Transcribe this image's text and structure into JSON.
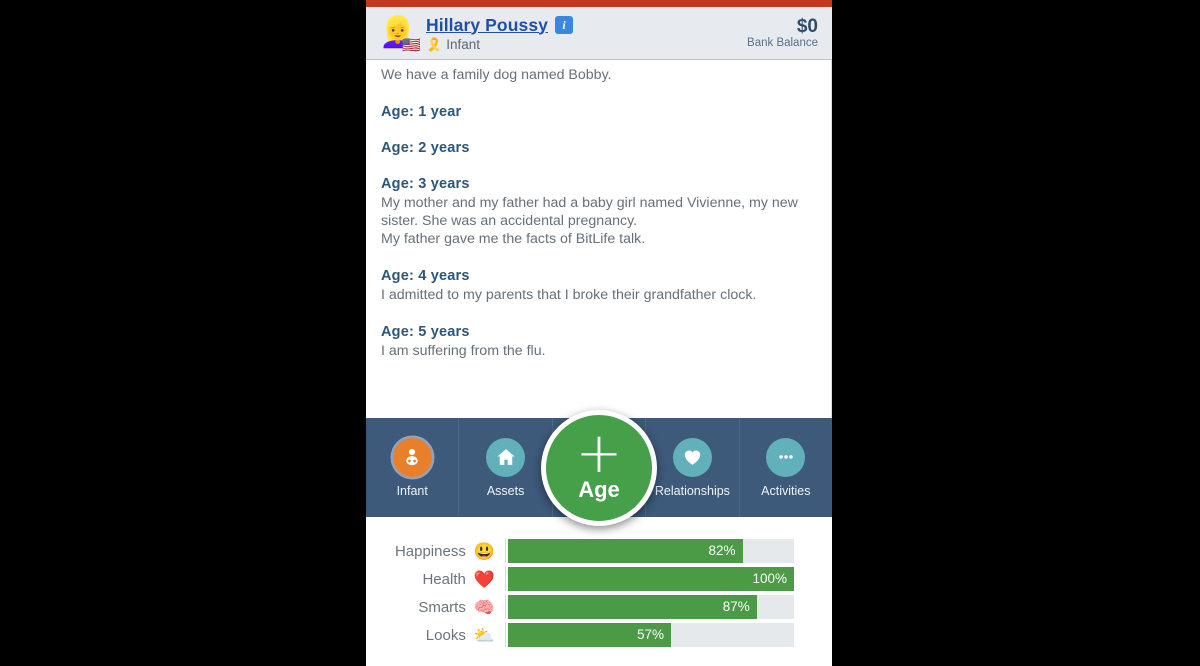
{
  "status_strip_color": "#c03a1d",
  "header": {
    "avatar_icon": "blonde-woman-emoji",
    "avatar_glyph": "👱‍♀️",
    "flag_icon": "us-flag",
    "flag_glyph": "🇺🇸",
    "name": "Hillary Poussy",
    "info_badge": "i",
    "stage_icon": "ribbon-icon",
    "stage_glyph": "🎗️",
    "stage_label": "Infant",
    "bank_amount": "$0",
    "bank_label": "Bank Balance"
  },
  "events": {
    "intro_line": "We have a family dog named Bobby.",
    "entries": [
      {
        "heading": "Age: 1 year",
        "lines": []
      },
      {
        "heading": "Age: 2 years",
        "lines": []
      },
      {
        "heading": "Age: 3 years",
        "lines": [
          "My mother and my father had a baby girl named Vivienne, my new sister. She was an accidental pregnancy.",
          "My father gave me the facts of BitLife talk."
        ]
      },
      {
        "heading": "Age: 4 years",
        "lines": [
          "I admitted to my parents that I broke their grandfather clock."
        ]
      },
      {
        "heading": "Age: 5 years",
        "lines": [
          "I am suffering from the flu."
        ]
      }
    ]
  },
  "nav": {
    "background": "#3d5a7a",
    "items": [
      {
        "label": "Infant",
        "icon": "baby-icon",
        "active": true,
        "color": "#e8802b"
      },
      {
        "label": "Assets",
        "icon": "house-icon",
        "active": false,
        "color": "#62b0ba"
      },
      {
        "label": "Relationships",
        "icon": "heart-icon",
        "active": false,
        "color": "#62b0ba"
      },
      {
        "label": "Activities",
        "icon": "ellipsis-icon",
        "active": false,
        "color": "#62b0ba"
      }
    ],
    "age_button": {
      "label": "Age",
      "icon": "plus-icon",
      "color": "#46a04a"
    }
  },
  "stats": {
    "bar_color": "#4a9a46",
    "track_color": "#e6e9eb",
    "rows": [
      {
        "label": "Happiness",
        "icon": "grinning-face-icon",
        "glyph": "😃",
        "value": 82,
        "display": "82%"
      },
      {
        "label": "Health",
        "icon": "red-heart-icon",
        "glyph": "❤️",
        "value": 100,
        "display": "100%"
      },
      {
        "label": "Smarts",
        "icon": "brain-icon",
        "glyph": "🧠",
        "value": 87,
        "display": "87%"
      },
      {
        "label": "Looks",
        "icon": "sun-behind-cloud-icon",
        "glyph": "⛅",
        "value": 57,
        "display": "57%"
      }
    ]
  }
}
